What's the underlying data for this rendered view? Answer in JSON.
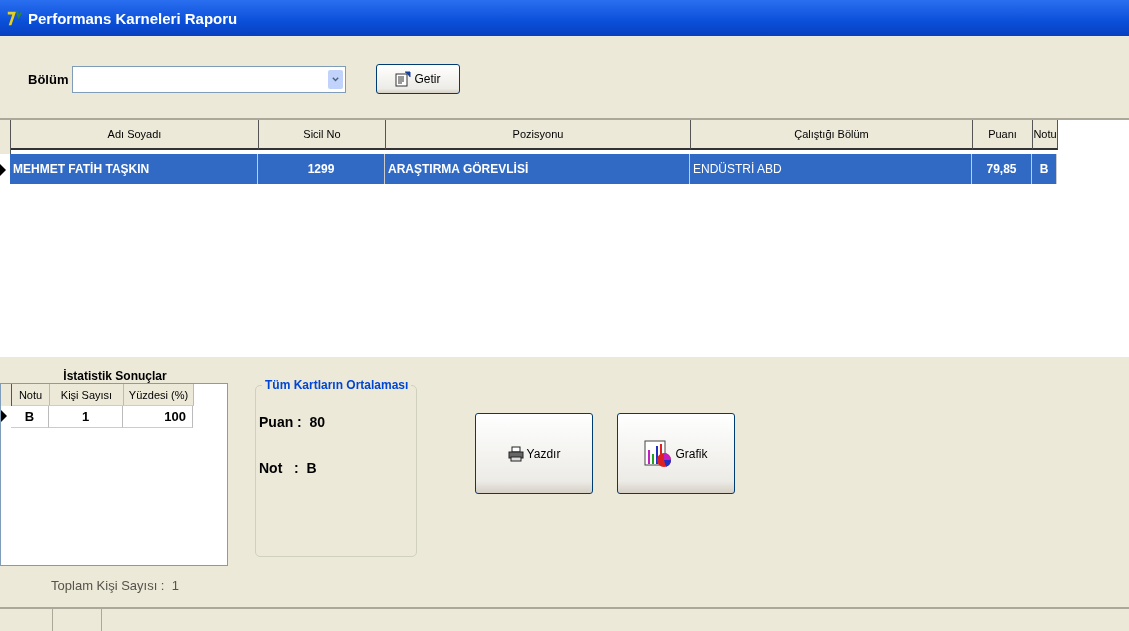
{
  "window": {
    "title": "Performans Karneleri Raporu"
  },
  "filter": {
    "label": "Bölüm",
    "button": "Getir"
  },
  "table": {
    "columns": [
      "Adı Soyadı",
      "Sicil No",
      "Pozisyonu",
      "Çalıştığı Bölüm",
      "Puanı",
      "Notu"
    ],
    "rows": [
      {
        "selected": true,
        "cells": [
          "MEHMET FATİH TAŞKIN",
          "1299",
          "ARAŞTIRMA GÖREVLİSİ",
          "ENDÜSTRİ ABD",
          "79,85",
          "B"
        ]
      }
    ]
  },
  "stats": {
    "title": "İstatistik Sonuçlar",
    "columns": [
      "Notu",
      "Kişi Sayısı",
      "Yüzdesi (%)"
    ],
    "rows": [
      {
        "selected": true,
        "cells": [
          "B",
          "1",
          "100"
        ]
      }
    ],
    "total": "Toplam Kişi Sayısı :  1"
  },
  "average": {
    "title": "Tüm Kartların Ortalaması",
    "lines": [
      "Puan :  80",
      "Not   :  B"
    ]
  },
  "buttons": [
    {
      "kind": "print",
      "label": "Yazdır"
    },
    {
      "kind": "chart",
      "label": "Grafik"
    }
  ]
}
